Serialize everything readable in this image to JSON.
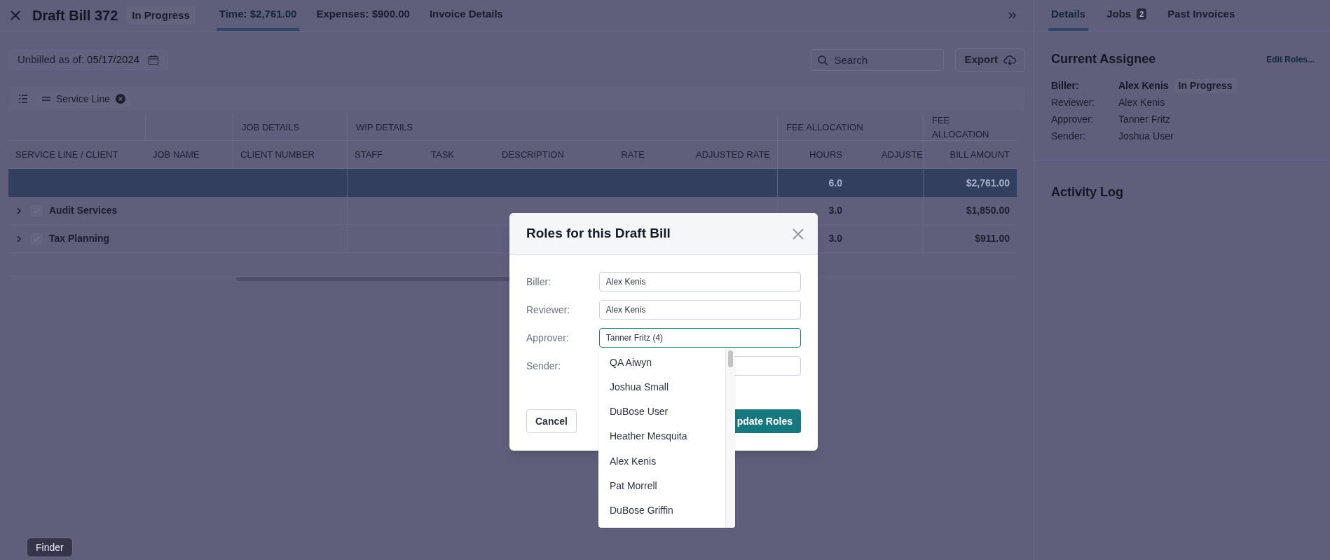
{
  "header": {
    "title": "Draft Bill 372",
    "status": "In Progress",
    "tabs": [
      {
        "label": "Time: $2,761.00",
        "selected": true
      },
      {
        "label": "Expenses: $900.00",
        "selected": false
      },
      {
        "label": "Invoice Details",
        "selected": false
      }
    ]
  },
  "toolbar": {
    "unbilled_label": "Unbilled as of:",
    "unbilled_date": "05/17/2024",
    "search_placeholder": "Search",
    "export": "Export"
  },
  "grouping": {
    "chips": [
      {
        "label": "Service Line"
      }
    ]
  },
  "table": {
    "group_headers": [
      "JOB DETAILS",
      "WIP DETAILS",
      "FEE ALLOCATION",
      "FEE ALLOCATION"
    ],
    "columns": [
      "SERVICE LINE / CLIENT",
      "JOB NAME",
      "CLIENT NUMBER",
      "STAFF",
      "TASK",
      "DESCRIPTION",
      "RATE",
      "ADJUSTED RATE",
      "HOURS",
      "ADJUSTE",
      "BILL AMOUNT"
    ],
    "total": {
      "hours": "6.0",
      "bill_amount": "$2,761.00"
    },
    "rows": [
      {
        "name": "Audit Services",
        "expanded": false,
        "checked": true,
        "hours": "3.0",
        "bill_amount": "$1,850.00"
      },
      {
        "name": "Tax Planning",
        "expanded": false,
        "checked": true,
        "hours": "3.0",
        "bill_amount": "$911.00"
      }
    ]
  },
  "side_panel": {
    "tabs": [
      {
        "label": "Details",
        "selected": true
      },
      {
        "label": "Jobs",
        "selected": false,
        "badge": "2"
      },
      {
        "label": "Past Invoices",
        "selected": false
      }
    ],
    "assignee_title": "Current Assignee",
    "edit_link": "Edit Roles...",
    "roles": [
      {
        "label": "Biller:",
        "value": "Alex Kenis",
        "current": true,
        "badge": "In Progress"
      },
      {
        "label": "Reviewer:",
        "value": "Alex Kenis",
        "current": false
      },
      {
        "label": "Approver:",
        "value": "Tanner Fritz",
        "current": false
      },
      {
        "label": "Sender:",
        "value": "Joshua User",
        "current": false
      }
    ],
    "activity_title": "Activity Log"
  },
  "modal": {
    "title": "Roles for this Draft Bill",
    "fields": [
      {
        "label": "Biller:",
        "value": "Alex Kenis",
        "focused": false
      },
      {
        "label": "Reviewer:",
        "value": "Alex Kenis",
        "focused": false
      },
      {
        "label": "Approver:",
        "value": "Tanner Fritz (4)",
        "focused": true
      },
      {
        "label": "Sender:",
        "focused": false
      }
    ],
    "dropdown": [
      "QA Aiwyn",
      "Joshua Small",
      "DuBose User",
      "Heather Mesquita",
      "Alex Kenis",
      "Pat Morrell",
      "DuBose Griffin"
    ],
    "cancel": "Cancel",
    "submit": "pdate Roles"
  },
  "tooltip": "Finder"
}
